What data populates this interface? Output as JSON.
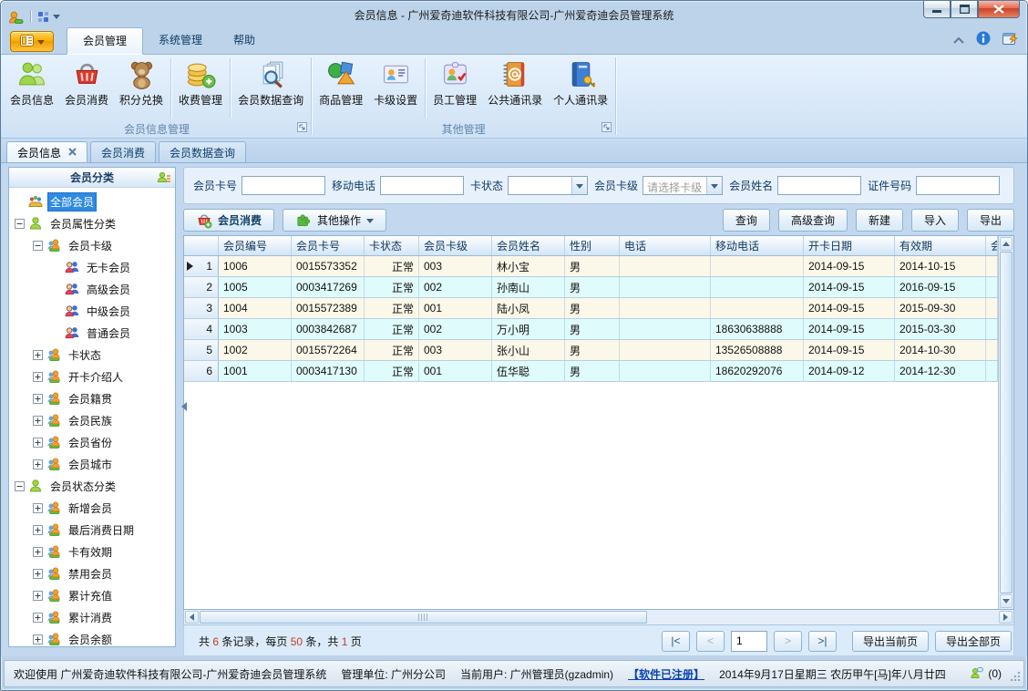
{
  "window": {
    "title": "会员信息 - 广州爱奇迪软件科技有限公司-广州爱奇迪会员管理系统"
  },
  "ribbon_tabs": [
    {
      "label": "会员管理",
      "name": "member-mgmt",
      "active": true
    },
    {
      "label": "系统管理",
      "name": "system-mgmt"
    },
    {
      "label": "帮助",
      "name": "help"
    }
  ],
  "ribbon_groups": [
    {
      "label": "会员信息管理",
      "name": "member-info-mgmt",
      "buttons": [
        {
          "label": "会员信息",
          "name": "member-info-button",
          "icon": "members"
        },
        {
          "label": "会员消费",
          "name": "member-consume-button",
          "icon": "basket"
        },
        {
          "label": "积分兑换",
          "name": "points-exchange-button",
          "icon": "teddy",
          "sep_after": true
        },
        {
          "label": "收费管理",
          "name": "fee-mgmt-button",
          "icon": "coins",
          "sep_after": true
        },
        {
          "label": "会员数据查询",
          "name": "member-data-query-button",
          "icon": "doc-search"
        }
      ]
    },
    {
      "label": "其他管理",
      "name": "other-mgmt",
      "buttons": [
        {
          "label": "商品管理",
          "name": "goods-mgmt-button",
          "icon": "shapes"
        },
        {
          "label": "卡级设置",
          "name": "card-level-button",
          "icon": "card",
          "sep_after": true
        },
        {
          "label": "员工管理",
          "name": "staff-mgmt-button",
          "icon": "staff"
        },
        {
          "label": "公共通讯录",
          "name": "public-contacts-button",
          "icon": "book-at"
        },
        {
          "label": "个人通讯录",
          "name": "personal-contacts-button",
          "icon": "book-key"
        }
      ]
    }
  ],
  "doc_tabs": [
    {
      "label": "会员信息",
      "name": "member-info",
      "active": true,
      "closable": true
    },
    {
      "label": "会员消费",
      "name": "member-consume"
    },
    {
      "label": "会员数据查询",
      "name": "member-data-query"
    }
  ],
  "sidebar": {
    "header": "会员分类",
    "tree": [
      {
        "label": "全部会员",
        "name": "all-members",
        "level": 1,
        "icon": "group",
        "selected": true
      },
      {
        "label": "会员属性分类",
        "name": "member-attribute-category",
        "level": 1,
        "icon": "user",
        "expander": "minus"
      },
      {
        "label": "会员卡级",
        "name": "member-card-level",
        "level": 2,
        "icon": "users",
        "expander": "minus"
      },
      {
        "label": "无卡会员",
        "name": "no-card-member",
        "level": 3,
        "icon": "users2"
      },
      {
        "label": "高级会员",
        "name": "senior-member",
        "level": 3,
        "icon": "users2"
      },
      {
        "label": "中级会员",
        "name": "middle-member",
        "level": 3,
        "icon": "users2"
      },
      {
        "label": "普通会员",
        "name": "normal-member",
        "level": 3,
        "icon": "users2"
      },
      {
        "label": "卡状态",
        "name": "card-status",
        "level": 2,
        "icon": "users",
        "expander": "plus"
      },
      {
        "label": "开卡介绍人",
        "name": "card-introducer",
        "level": 2,
        "icon": "users",
        "expander": "plus"
      },
      {
        "label": "会员籍贯",
        "name": "member-birthplace",
        "level": 2,
        "icon": "users",
        "expander": "plus"
      },
      {
        "label": "会员民族",
        "name": "member-ethnicity",
        "level": 2,
        "icon": "users",
        "expander": "plus"
      },
      {
        "label": "会员省份",
        "name": "member-province",
        "level": 2,
        "icon": "users",
        "expander": "plus"
      },
      {
        "label": "会员城市",
        "name": "member-city",
        "level": 2,
        "icon": "users",
        "expander": "plus"
      },
      {
        "label": "会员状态分类",
        "name": "member-status-category",
        "level": 1,
        "icon": "user",
        "expander": "minus"
      },
      {
        "label": "新增会员",
        "name": "new-members",
        "level": 2,
        "icon": "users",
        "expander": "plus"
      },
      {
        "label": "最后消费日期",
        "name": "last-consume-date",
        "level": 2,
        "icon": "users",
        "expander": "plus"
      },
      {
        "label": "卡有效期",
        "name": "card-validity",
        "level": 2,
        "icon": "users",
        "expander": "plus"
      },
      {
        "label": "禁用会员",
        "name": "disabled-members",
        "level": 2,
        "icon": "users",
        "expander": "plus"
      },
      {
        "label": "累计充值",
        "name": "total-recharge",
        "level": 2,
        "icon": "users",
        "expander": "plus"
      },
      {
        "label": "累计消费",
        "name": "total-consume",
        "level": 2,
        "icon": "users",
        "expander": "plus"
      },
      {
        "label": "会员余额",
        "name": "member-balance",
        "level": 2,
        "icon": "users",
        "expander": "plus"
      }
    ]
  },
  "filters": [
    {
      "label": "会员卡号",
      "name": "member-card-no-field",
      "type": "text",
      "value": ""
    },
    {
      "label": "移动电话",
      "name": "mobile-field",
      "type": "text",
      "value": ""
    },
    {
      "label": "卡状态",
      "name": "card-status-combo",
      "type": "combo",
      "value": ""
    },
    {
      "label": "会员卡级",
      "name": "card-level-combo",
      "type": "combo",
      "value": "请选择卡级",
      "is_placeholder": true
    },
    {
      "label": "会员姓名",
      "name": "member-name-field",
      "type": "text",
      "value": ""
    },
    {
      "label": "证件号码",
      "name": "id-number-field",
      "type": "text",
      "value": ""
    }
  ],
  "toolbar": {
    "left": [
      {
        "label": "会员消费",
        "name": "member-consume-action-button",
        "icon": "basket-plus",
        "primary": true
      },
      {
        "label": "其他操作",
        "name": "other-actions-button",
        "icon": "puzzle",
        "caret": true
      }
    ],
    "right": [
      {
        "label": "查询",
        "name": "query-button"
      },
      {
        "label": "高级查询",
        "name": "advanced-query-button"
      },
      {
        "label": "新建",
        "name": "new-button"
      },
      {
        "label": "导入",
        "name": "import-button"
      },
      {
        "label": "导出",
        "name": "export-button"
      }
    ]
  },
  "table": {
    "columns": [
      {
        "label": "会员编号",
        "width": 80
      },
      {
        "label": "会员卡号",
        "width": 80
      },
      {
        "label": "卡状态",
        "width": 60,
        "align": "right"
      },
      {
        "label": "会员卡级",
        "width": 80
      },
      {
        "label": "会员姓名",
        "width": 80
      },
      {
        "label": "性别",
        "width": 60
      },
      {
        "label": "电话",
        "width": 100
      },
      {
        "label": "移动电话",
        "width": 102
      },
      {
        "label": "开卡日期",
        "width": 100
      },
      {
        "label": "有效期",
        "width": 100
      },
      {
        "label": "会员",
        "width": 0
      }
    ],
    "rows": [
      {
        "num": "1",
        "selected": true,
        "cells": [
          "1006",
          "0015573352",
          "正常",
          "003",
          "林小宝",
          "男",
          "",
          "",
          "2014-09-15",
          "2014-10-15",
          ""
        ]
      },
      {
        "num": "2",
        "cells": [
          "1005",
          "0003417269",
          "正常",
          "002",
          "孙南山",
          "男",
          "",
          "",
          "2014-09-15",
          "2016-09-15",
          ""
        ]
      },
      {
        "num": "3",
        "cells": [
          "1004",
          "0015572389",
          "正常",
          "001",
          "陆小凤",
          "男",
          "",
          "",
          "2014-09-15",
          "2015-09-30",
          ""
        ]
      },
      {
        "num": "4",
        "cells": [
          "1003",
          "0003842687",
          "正常",
          "002",
          "万小明",
          "男",
          "",
          "18630638888",
          "2014-09-15",
          "2015-03-30",
          ""
        ]
      },
      {
        "num": "5",
        "cells": [
          "1002",
          "0015572264",
          "正常",
          "003",
          "张小山",
          "男",
          "",
          "13526508888",
          "2014-09-15",
          "2014-10-30",
          ""
        ]
      },
      {
        "num": "6",
        "cells": [
          "1001",
          "0003417130",
          "正常",
          "001",
          "伍华聪",
          "男",
          "",
          "18620292076",
          "2014-09-12",
          "2014-12-30",
          ""
        ]
      }
    ]
  },
  "pagination": {
    "summary": [
      {
        "t": "共 "
      },
      {
        "t": "6",
        "red": true
      },
      {
        "t": " 条记录，每页 "
      },
      {
        "t": "50",
        "red": true
      },
      {
        "t": " 条，共 "
      },
      {
        "t": "1",
        "red": true
      },
      {
        "t": " 页"
      }
    ],
    "nav_first": "|<",
    "nav_prev": "<",
    "page": "1",
    "nav_next": ">",
    "nav_last": ">|",
    "export_current": "导出当前页",
    "export_all": "导出全部页"
  },
  "statusbar": {
    "welcome": "欢迎使用 广州爱奇迪软件科技有限公司-广州爱奇迪会员管理系统",
    "unit": "管理单位: 广州分公司",
    "user": "当前用户: 广州管理员(gzadmin)",
    "registered": "【软件已注册】",
    "date": "2014年9月17日星期三 农历甲午[马]年八月廿四",
    "msg_count": "(0)"
  }
}
